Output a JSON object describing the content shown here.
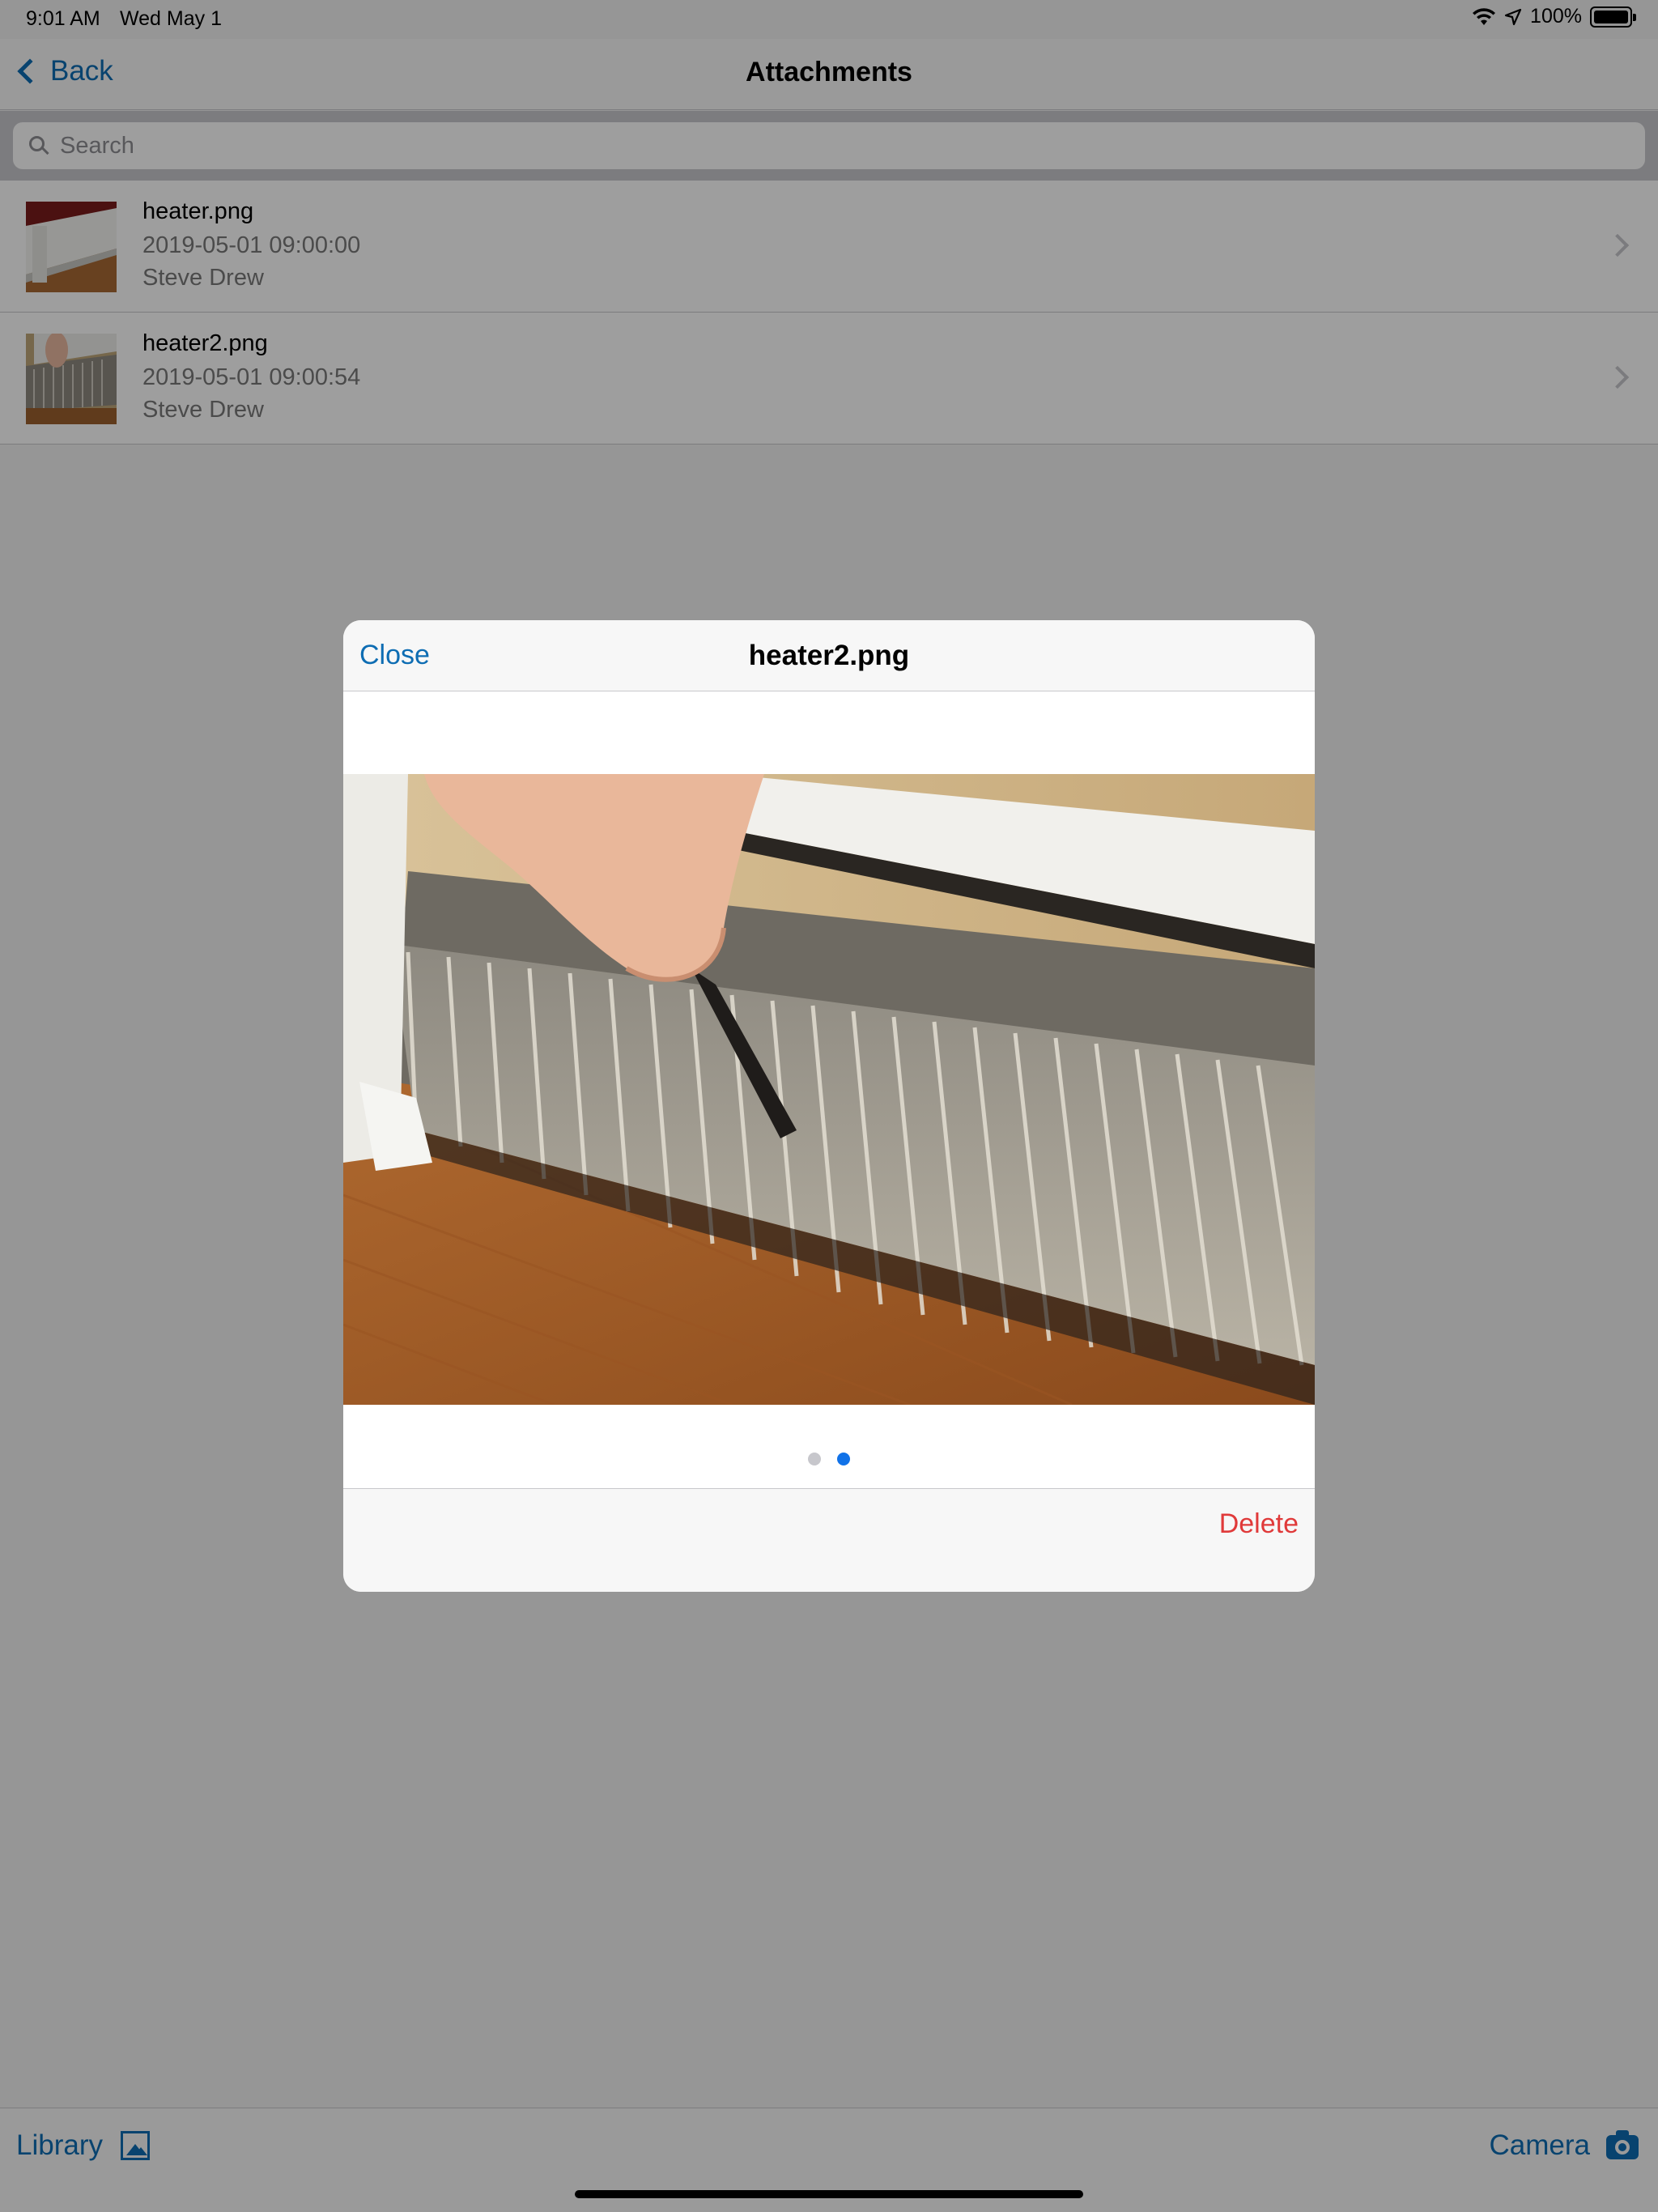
{
  "status_bar": {
    "time": "9:01 AM",
    "date": "Wed May 1",
    "battery": "100%",
    "icons": [
      "wifi-icon",
      "location-icon",
      "battery-icon"
    ]
  },
  "nav": {
    "back_label": "Back",
    "title": "Attachments"
  },
  "search": {
    "placeholder": "Search",
    "value": ""
  },
  "attachments": [
    {
      "name": "heater.png",
      "date": "2019-05-01 09:00:00",
      "author": "Steve Drew"
    },
    {
      "name": "heater2.png",
      "date": "2019-05-01 09:00:54",
      "author": "Steve Drew"
    }
  ],
  "toolbar": {
    "library_label": "Library",
    "camera_label": "Camera"
  },
  "modal": {
    "close_label": "Close",
    "title": "heater2.png",
    "delete_label": "Delete",
    "page_count": 2,
    "current_page": 2
  },
  "colors": {
    "accent": "#0e6db3",
    "destructive": "#e03a3a",
    "page_indicator_active": "#1172e8"
  }
}
